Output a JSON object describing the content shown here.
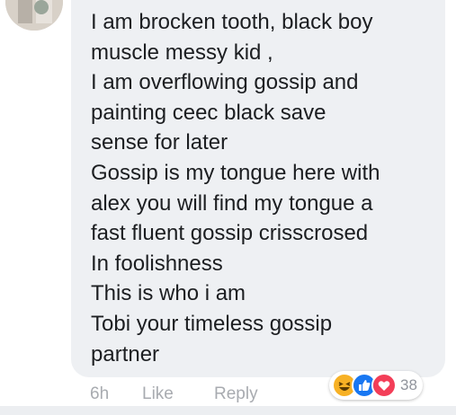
{
  "comment": {
    "lines": [
      "I am brocken tooth, black boy",
      "muscle messy kid ,",
      "I am overflowing gossip and",
      "painting ceec black save",
      "sense for later",
      "Gossip is my tongue here with",
      "alex you will find my tongue a",
      "fast fluent gossip crisscrosed",
      "In foolishness",
      "This is who i am",
      "Tobi your timeless gossip",
      "partner"
    ]
  },
  "actions": {
    "time": "6h",
    "like": "Like",
    "reply": "Reply"
  },
  "reactions": {
    "icons": [
      "haha-icon",
      "like-icon",
      "love-icon"
    ],
    "count": "38"
  },
  "colors": {
    "bubble": "#eef0f3",
    "text": "#1c1e21",
    "muted": "#a8abb0",
    "like_blue": "#1877f2",
    "love_red": "#f33e58",
    "haha_yellow": "#f7b125"
  }
}
